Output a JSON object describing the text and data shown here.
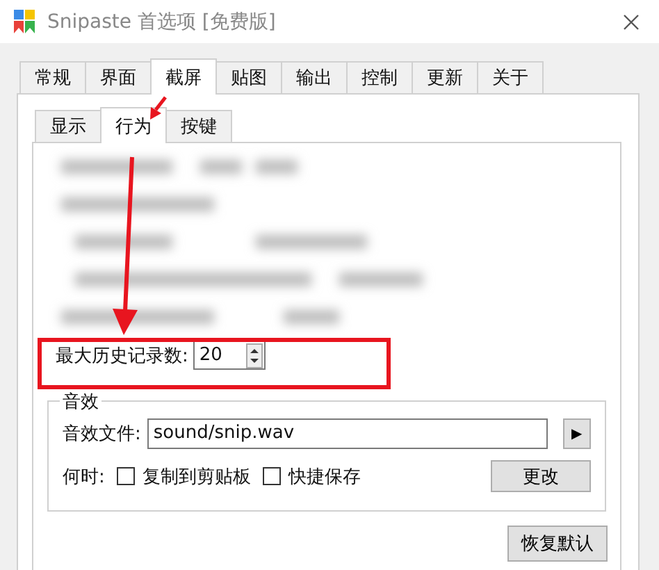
{
  "window": {
    "title": "Snipaste 首选项 [免费版]"
  },
  "tabs": [
    {
      "label": "常规",
      "selected": false
    },
    {
      "label": "界面",
      "selected": false
    },
    {
      "label": "截屏",
      "selected": true
    },
    {
      "label": "贴图",
      "selected": false
    },
    {
      "label": "输出",
      "selected": false
    },
    {
      "label": "控制",
      "selected": false
    },
    {
      "label": "更新",
      "selected": false
    },
    {
      "label": "关于",
      "selected": false
    }
  ],
  "subtabs": [
    {
      "label": "显示",
      "selected": false
    },
    {
      "label": "行为",
      "selected": true
    },
    {
      "label": "按键",
      "selected": false
    }
  ],
  "max_history": {
    "label": "最大历史记录数:",
    "value": "20"
  },
  "sound": {
    "title": "音效",
    "file_label": "音效文件:",
    "file_value": "sound/snip.wav",
    "play_button": "▶",
    "when_label": "何时:",
    "options": [
      {
        "label": "复制到剪贴板",
        "checked": false
      },
      {
        "label": "快捷保存",
        "checked": false
      }
    ],
    "change_button": "更改"
  },
  "restore_button": "恢复默认"
}
